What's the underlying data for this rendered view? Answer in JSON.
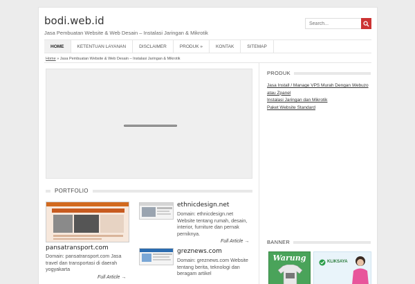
{
  "header": {
    "site_title": "bodi.web.id",
    "tagline": "Jasa Pembuatan Website & Web Desain – Instalasi Jaringan & Mikrotik",
    "search_placeholder": "Search..."
  },
  "nav": {
    "items": [
      {
        "label": "HOME",
        "active": true
      },
      {
        "label": "KETENTUAN LAYANAN"
      },
      {
        "label": "DISCLAIMER"
      },
      {
        "label": "PRODUK »"
      },
      {
        "label": "KONTAK"
      },
      {
        "label": "SITEMAP"
      }
    ]
  },
  "breadcrumb": {
    "home": "Home",
    "separator": "»",
    "current": "Jasa Pembuatan Website & Web Desain – Instalasi Jaringan & Mikrotik"
  },
  "portfolio": {
    "title": "PORTFOLIO",
    "items": [
      {
        "title": "pansatransport.com",
        "text": "Domain: pansatransport.com Jasa travel dan transportasi di daerah yogyakarta",
        "more": "Full Article →"
      },
      {
        "title": "ethnicdesign.net",
        "text": "Domain: ethnicdesign.net Website tentang rumah, desain, interior, furniture dan pernak perniknya.",
        "more": "Full Article →"
      },
      {
        "title": "greznews.com",
        "text": "Domain: greznews.com Website tentang berita, teknologi dan beragam artikel",
        "more": ""
      }
    ]
  },
  "sidebar": {
    "produk_title": "PRODUK",
    "links": [
      "Jasa Install / Manage VPS Murah Dengan Webuzo atau Zpanel",
      "Instalasi Jaringan dan Mikrotik",
      "Paket Website Standard"
    ],
    "banner_title": "BANNER",
    "banners": [
      "Warung",
      "KLIKSAYA"
    ]
  },
  "colors": {
    "accent": "#cc3333",
    "background": "#ececec",
    "panel": "#ffffff"
  }
}
